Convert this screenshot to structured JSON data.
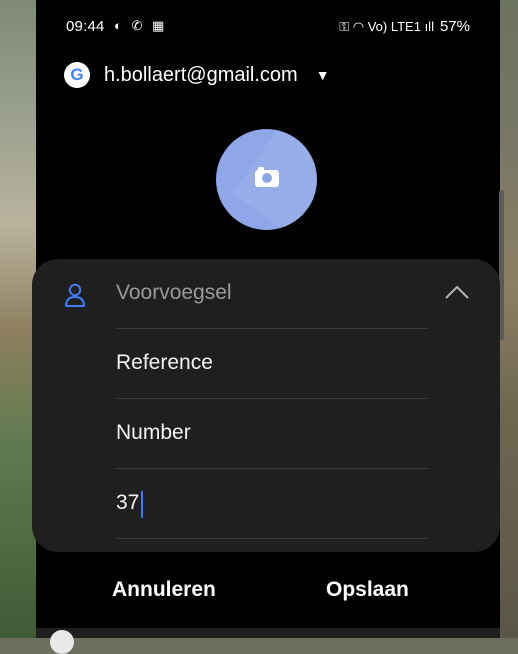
{
  "status": {
    "time": "09:44",
    "left_icons": "◐ ✆ ▦",
    "right_icons": "⚿ ◠ Vo) LTE1 ıll",
    "battery": "57%"
  },
  "account": {
    "email": "h.bollaert@gmail.com",
    "caret": "▼",
    "logo_letter": "G"
  },
  "form": {
    "prefix_placeholder": "Voorvoegsel",
    "first_name_value": "Reference",
    "last_name_value": "Number",
    "suffix_value": "37"
  },
  "actions": {
    "cancel_label": "Annuleren",
    "save_label": "Opslaan"
  },
  "colors": {
    "accent": "#3d7cf5",
    "avatar_bg": "#8fa6e8",
    "card_bg": "#1f1f1f"
  }
}
